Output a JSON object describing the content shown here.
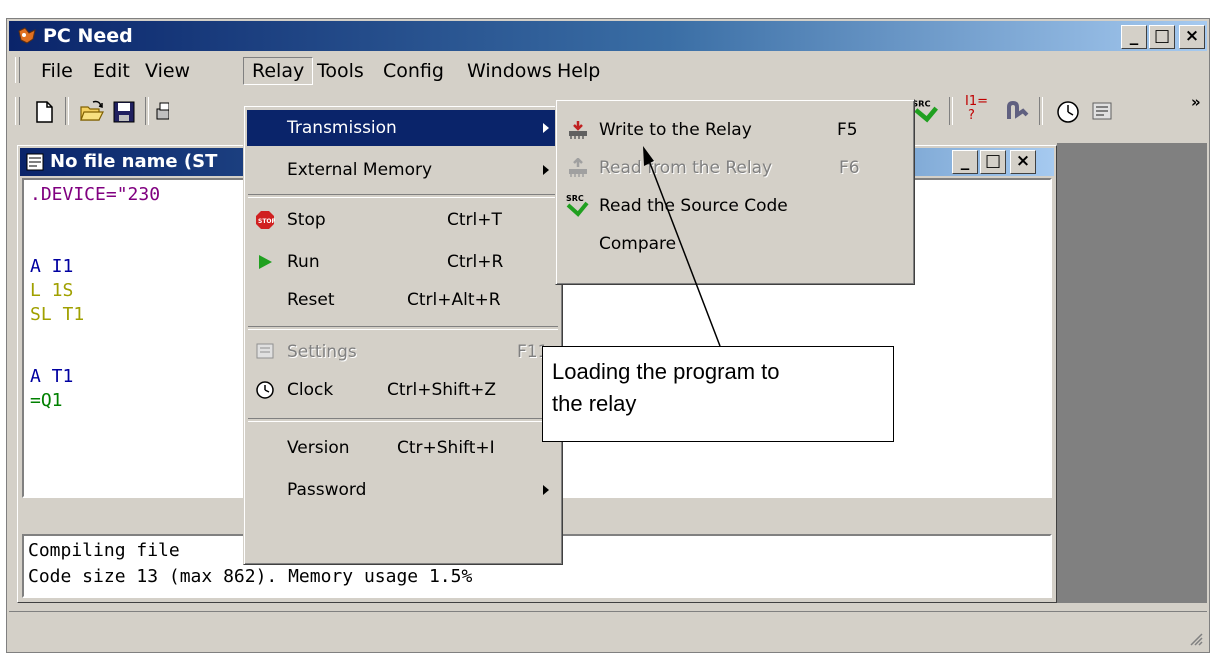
{
  "window": {
    "title": "PC Need",
    "caption_buttons": {
      "minimize": "_",
      "maximize": "□",
      "close": "×"
    }
  },
  "menubar": {
    "items": [
      "File",
      "Edit",
      "View",
      "Relay",
      "Tools",
      "Config",
      "Windows",
      "Help"
    ],
    "active": "Relay"
  },
  "toolbar": {
    "icons": [
      "new-file-icon",
      "open-folder-icon",
      "save-icon",
      "print-icon",
      "read-source-icon",
      "input-status-icon",
      "monitor-icon",
      "clock-icon",
      "settings-icon"
    ],
    "chevron": "»",
    "input_label": "I1=",
    "input_sub": "?",
    "src_label": "SRC"
  },
  "child_window": {
    "title": "No file name (ST",
    "code_lines": [
      ".DEVICE=\"230",
      "",
      "A I1",
      "L 1S",
      "SL T1",
      "",
      "A T1",
      "=Q1"
    ],
    "output_lines": [
      "Compiling file",
      "Code size 13 (max 862). Memory usage 1.5%"
    ]
  },
  "relay_menu": {
    "items": [
      {
        "label": "Transmission",
        "shortcut": "",
        "submenu": true,
        "highlighted": true
      },
      {
        "label": "External Memory",
        "shortcut": "",
        "submenu": true
      },
      {
        "label": "Stop",
        "shortcut": "Ctrl+T",
        "icon": "stop-icon"
      },
      {
        "label": "Run",
        "shortcut": "Ctrl+R",
        "icon": "run-icon"
      },
      {
        "label": "Reset",
        "shortcut": "Ctrl+Alt+R"
      },
      {
        "label": "Settings",
        "shortcut": "F11",
        "disabled": true,
        "icon": "settings-icon"
      },
      {
        "label": "Clock",
        "shortcut": "Ctrl+Shift+Z",
        "icon": "clock-icon"
      },
      {
        "label": "Version",
        "shortcut": "Ctr+Shift+I"
      },
      {
        "label": "Password",
        "shortcut": "",
        "submenu": true
      }
    ]
  },
  "transmission_submenu": {
    "items": [
      {
        "label": "Write to the Relay",
        "shortcut": "F5",
        "icon": "write-relay-icon"
      },
      {
        "label": "Read from the Relay",
        "shortcut": "F6",
        "disabled": true,
        "icon": "read-relay-icon"
      },
      {
        "label": "Read the Source Code",
        "shortcut": "",
        "icon": "read-source-icon"
      },
      {
        "label": "Compare",
        "shortcut": ""
      }
    ]
  },
  "callout": {
    "lines": [
      "Loading the program to",
      "the relay"
    ]
  },
  "colors": {
    "titlebar": "#0a246a",
    "highlight": "#0a246a",
    "code_blue": "#0000a0",
    "code_olive": "#a0a000",
    "code_purple": "#800080",
    "code_green": "#008000"
  }
}
